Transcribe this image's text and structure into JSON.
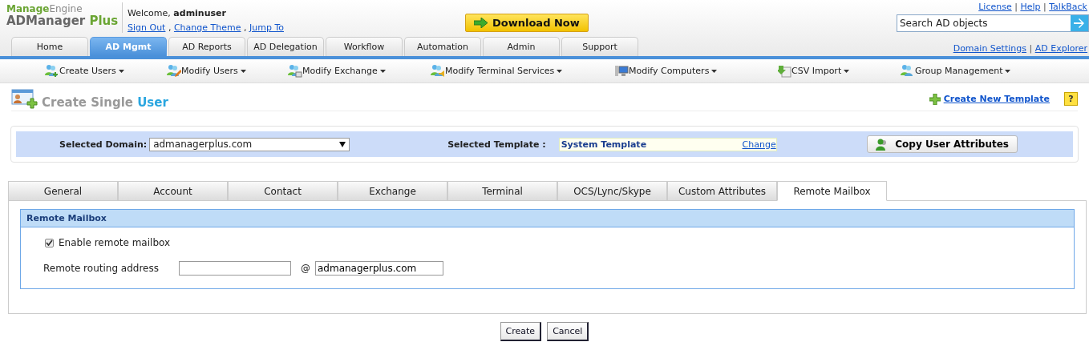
{
  "logo": {
    "company_parts": [
      "Manage",
      "Engine"
    ],
    "product_parts": [
      "ADManager",
      "Plus"
    ]
  },
  "welcome": {
    "label": "Welcome,",
    "user": "adminuser",
    "links": [
      "Sign Out",
      "Change Theme",
      "Jump To"
    ],
    "separator": ","
  },
  "download_button": "Download Now",
  "top_links": {
    "items": [
      "License",
      "Help",
      "TalkBack"
    ],
    "separator": "|"
  },
  "search": {
    "placeholder": "Search AD objects"
  },
  "nav_tabs": [
    {
      "label": "Home",
      "selected": false
    },
    {
      "label": "AD Mgmt",
      "selected": true
    },
    {
      "label": "AD Reports",
      "selected": false
    },
    {
      "label": "AD Delegation",
      "selected": false
    },
    {
      "label": "Workflow",
      "selected": false
    },
    {
      "label": "Automation",
      "selected": false
    },
    {
      "label": "Admin",
      "selected": false
    },
    {
      "label": "Support",
      "selected": false
    }
  ],
  "nav_links": {
    "items": [
      "Domain Settings",
      "AD Explorer"
    ],
    "separator": "|"
  },
  "sub_menu": [
    "Create Users",
    "Modify Users",
    "Modify Exchange",
    "Modify Terminal Services",
    "Modify Computers",
    "CSV Import",
    "Group Management"
  ],
  "page_title": {
    "parts": [
      "Create Single",
      "User"
    ],
    "create_template_link": "Create New Template",
    "help_button": "?"
  },
  "domain_bar": {
    "domain_label": "Selected Domain:",
    "domain_value": "admanagerplus.com",
    "template_label": "Selected Template :",
    "template_value": "System Template",
    "change_link": "Change",
    "copy_button": "Copy User Attributes"
  },
  "form_tabs": [
    {
      "label": "General",
      "selected": false
    },
    {
      "label": "Account",
      "selected": false
    },
    {
      "label": "Contact",
      "selected": false
    },
    {
      "label": "Exchange",
      "selected": false
    },
    {
      "label": "Terminal",
      "selected": false
    },
    {
      "label": "OCS/Lync/Skype",
      "selected": false
    },
    {
      "label": "Custom Attributes",
      "selected": false
    },
    {
      "label": "Remote Mailbox",
      "selected": true
    }
  ],
  "section": {
    "title": "Remote Mailbox",
    "enable": {
      "label": "Enable remote mailbox",
      "checked": true
    },
    "routing": {
      "label": "Remote routing address",
      "at": "@",
      "domain_value": "admanagerplus.com"
    }
  },
  "buttons": [
    "Create",
    "Cancel"
  ]
}
